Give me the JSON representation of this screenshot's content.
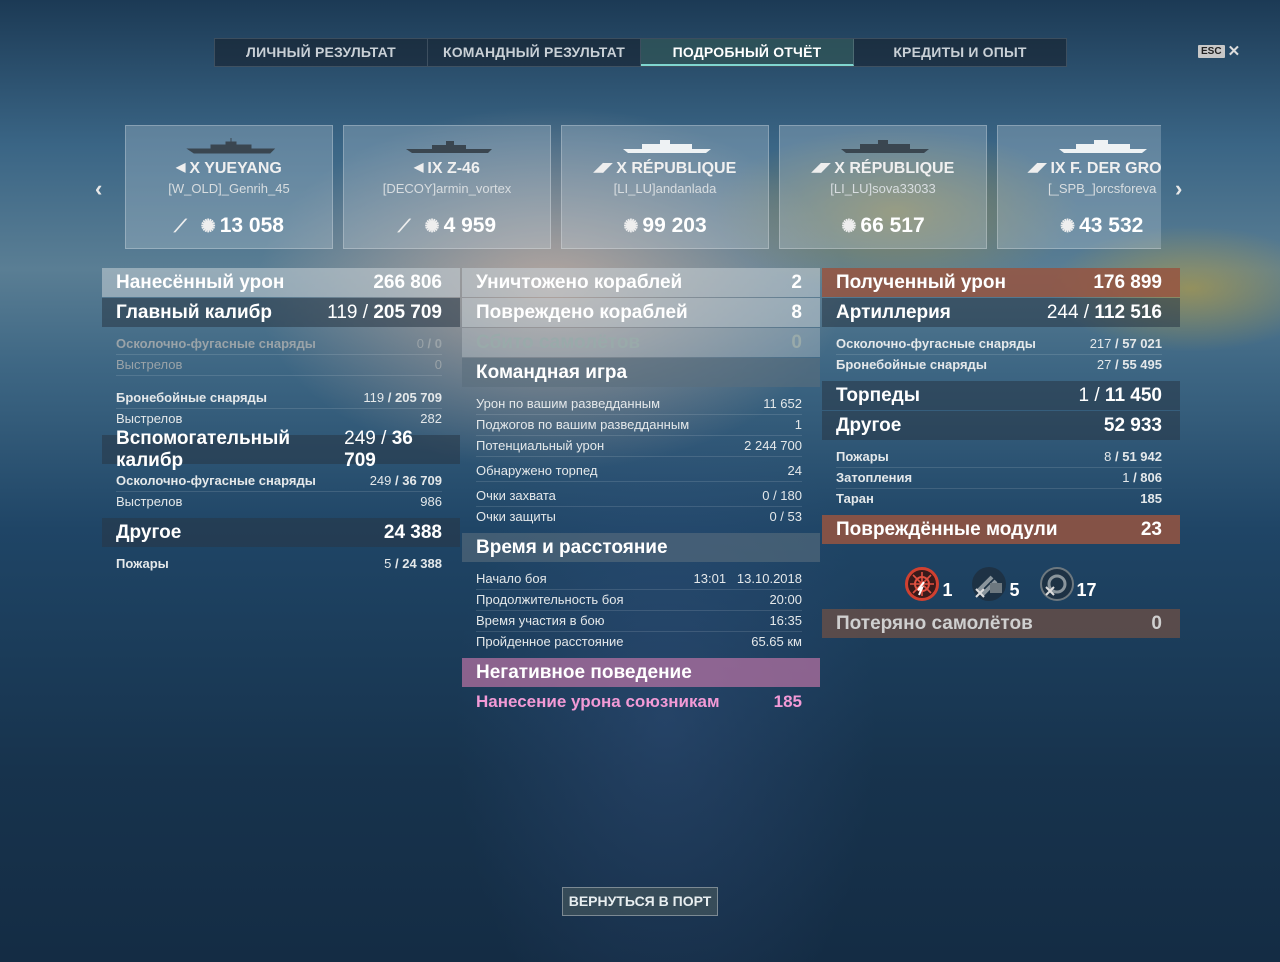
{
  "tabs": [
    "ЛИЧНЫЙ РЕЗУЛЬТАТ",
    "КОМАНДНЫЙ РЕЗУЛЬТАТ",
    "ПОДРОБНЫЙ ОТЧЁТ",
    "КРЕДИТЫ И ОПЫТ"
  ],
  "active_tab": "ПОДРОБНЫЙ ОТЧЁТ",
  "esc_label": "ESC",
  "ships": [
    {
      "name": "X YUEYANG",
      "player": "[W_OLD]_Genrih_45",
      "damage": "13 058",
      "sunk": true,
      "type": "destroyer"
    },
    {
      "name": "IX Z-46",
      "player": "[DECOY]armin_vortex",
      "damage": "4 959",
      "sunk": true,
      "type": "destroyer"
    },
    {
      "name": "X RÉPUBLIQUE",
      "player": "[LI_LU]andanlada",
      "damage": "99 203",
      "sunk": false,
      "type": "battleship"
    },
    {
      "name": "X RÉPUBLIQUE",
      "player": "[LI_LU]sova33033",
      "damage": "66 517",
      "sunk": false,
      "type": "battleship"
    },
    {
      "name": "IX F. DER GROßE",
      "player": "[_SPB_]orcsforeva",
      "damage": "43 532",
      "sunk": false,
      "type": "battleship"
    }
  ],
  "dealt": {
    "title": "Нанесённый урон",
    "total": "266 806",
    "main": {
      "label": "Главный калибр",
      "hits": "119",
      "value": "205 709"
    },
    "main_he": {
      "label": "Осколочно-фугасные снаряды",
      "hits": "0",
      "value": "0"
    },
    "main_he_shots": {
      "label": "Выстрелов",
      "value": "0"
    },
    "main_ap": {
      "label": "Бронебойные снаряды",
      "hits": "119",
      "value": "205 709"
    },
    "main_ap_shots": {
      "label": "Выстрелов",
      "value": "282"
    },
    "secondary": {
      "label": "Вспомогательный калибр",
      "hits": "249",
      "value": "36 709"
    },
    "sec_he": {
      "label": "Осколочно-фугасные снаряды",
      "hits": "249",
      "value": "36 709"
    },
    "sec_shots": {
      "label": "Выстрелов",
      "value": "986"
    },
    "other": {
      "label": "Другое",
      "value": "24 388"
    },
    "fires": {
      "label": "Пожары",
      "hits": "5",
      "value": "24 388"
    }
  },
  "team": {
    "destroyed": {
      "label": "Уничтожено кораблей",
      "value": "2"
    },
    "damaged": {
      "label": "Повреждено кораблей",
      "value": "8"
    },
    "planes": {
      "label": "Сбито самолётов",
      "value": "0"
    },
    "teamplay": "Командная игра",
    "spotting_dmg": {
      "label": "Урон по вашим разведданным",
      "value": "11 652"
    },
    "spotting_fires": {
      "label": "Поджогов по вашим разведданным",
      "value": "1"
    },
    "potential": {
      "label": "Потенциальный урон",
      "value": "2 244 700"
    },
    "torps_spotted": {
      "label": "Обнаружено торпед",
      "value": "24"
    },
    "capture": {
      "label": "Очки захвата",
      "value": "0 / 180"
    },
    "defense": {
      "label": "Очки защиты",
      "value": "0 / 53"
    },
    "time_title": "Время и расстояние",
    "start": {
      "label": "Начало боя",
      "time": "13:01",
      "date": "13.10.2018"
    },
    "duration": {
      "label": "Продолжительность боя",
      "value": "20:00"
    },
    "participation": {
      "label": "Время участия в бою",
      "value": "16:35"
    },
    "distance": {
      "label": "Пройденное расстояние",
      "value": "65.65 км"
    },
    "negative_title": "Негативное поведение",
    "team_damage": {
      "label": "Нанесение урона союзникам",
      "value": "185"
    }
  },
  "received": {
    "title": "Полученный урон",
    "total": "176 899",
    "artillery": {
      "label": "Артиллерия",
      "hits": "244",
      "value": "112 516"
    },
    "he": {
      "label": "Осколочно-фугасные снаряды",
      "hits": "217",
      "value": "57 021"
    },
    "ap": {
      "label": "Бронебойные снаряды",
      "hits": "27",
      "value": "55 495"
    },
    "torpedoes": {
      "label": "Торпеды",
      "hits": "1",
      "value": "11 450"
    },
    "other": {
      "label": "Другое",
      "value": "52 933"
    },
    "fires": {
      "label": "Пожары",
      "hits": "8",
      "value": "51 942"
    },
    "flooding": {
      "label": "Затопления",
      "hits": "1",
      "value": "806"
    },
    "ram": {
      "label": "Таран",
      "value": "185"
    },
    "modules_title": "Повреждённые модули",
    "modules_total": "23",
    "modules": [
      {
        "icon": "steering-gear-icon",
        "count": "1"
      },
      {
        "icon": "main-battery-icon",
        "count": "5"
      },
      {
        "icon": "secondary-battery-icon",
        "count": "17"
      }
    ],
    "planes_lost": {
      "label": "Потеряно самолётов",
      "value": "0"
    }
  },
  "back_button": "ВЕРНУТЬСЯ В ПОРТ"
}
